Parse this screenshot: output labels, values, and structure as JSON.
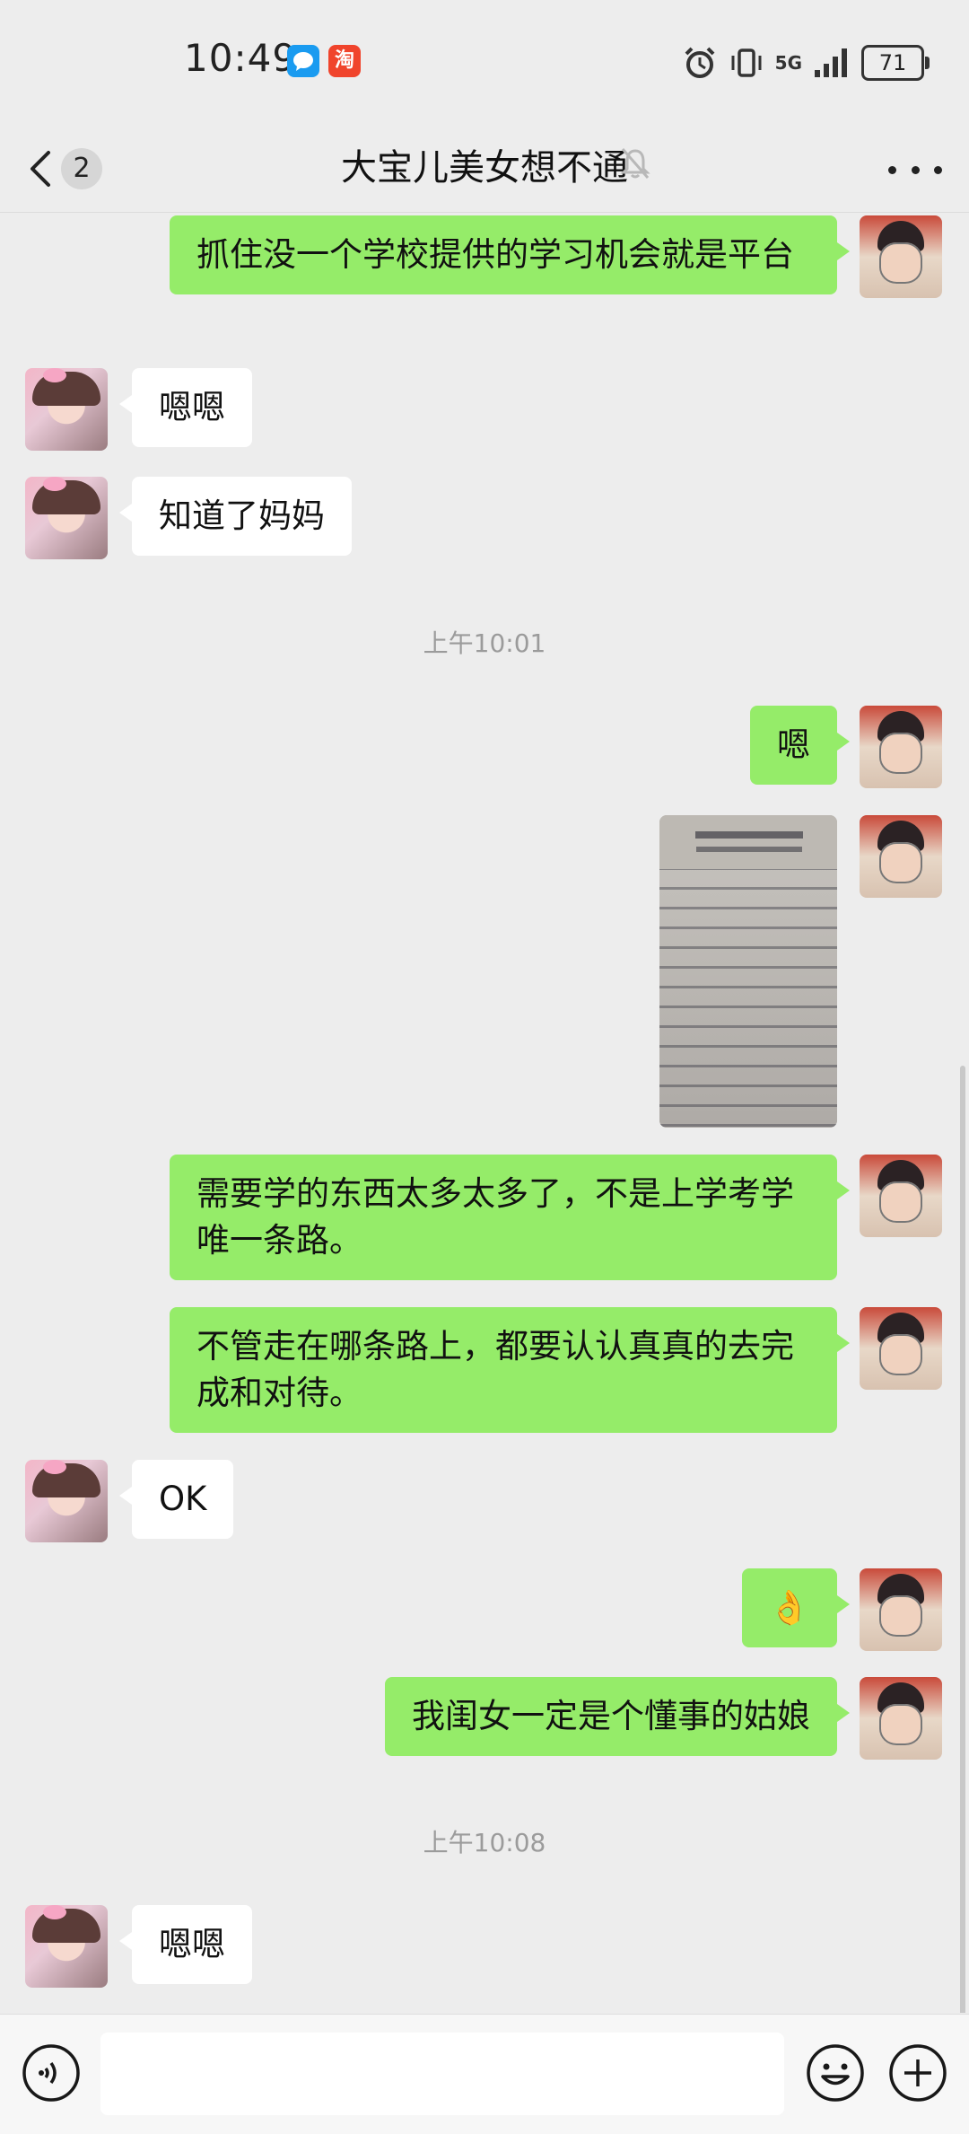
{
  "status_bar": {
    "time": "10:49",
    "notification_icons": [
      "chat-bubble-icon",
      "taobao-icon"
    ],
    "taobao_label": "淘",
    "network": "5G",
    "battery": "71"
  },
  "nav": {
    "title": "大宝儿美女想不通",
    "unread_count": "2"
  },
  "messages": [
    {
      "side": "right",
      "type": "text",
      "text": "抓住没一个学校提供的学习机会就是平台"
    },
    {
      "side": "left",
      "type": "text",
      "text": "嗯嗯"
    },
    {
      "side": "left",
      "type": "text",
      "text": "知道了妈妈"
    },
    {
      "type": "timestamp",
      "text": "上午10:01"
    },
    {
      "side": "right",
      "type": "text",
      "text": "嗯"
    },
    {
      "side": "right",
      "type": "image",
      "description": "photo of a printed book page"
    },
    {
      "side": "right",
      "type": "text",
      "text": "需要学的东西太多太多了，不是上学考学唯一条路。"
    },
    {
      "side": "right",
      "type": "text",
      "text": "不管走在哪条路上，都要认认真真的去完成和对待。"
    },
    {
      "side": "left",
      "type": "text",
      "text": "OK"
    },
    {
      "side": "right",
      "type": "text",
      "text": "👌"
    },
    {
      "side": "right",
      "type": "text",
      "text": "我闺女一定是个懂事的姑娘"
    },
    {
      "type": "timestamp",
      "text": "上午10:08"
    },
    {
      "side": "left",
      "type": "text",
      "text": "嗯嗯"
    }
  ],
  "input": {
    "value": "",
    "placeholder": ""
  },
  "colors": {
    "background": "#ededed",
    "bubble_self": "#95ec69",
    "bubble_other": "#ffffff",
    "timestamp": "#9b9b9b"
  }
}
